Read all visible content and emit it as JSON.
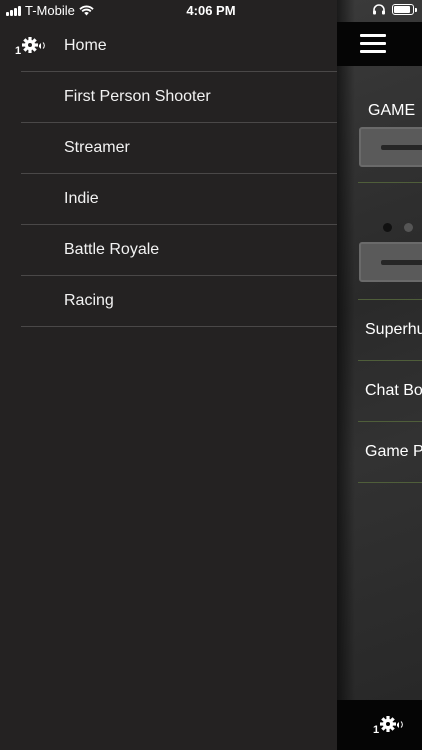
{
  "status_bar": {
    "carrier": "T-Mobile",
    "time": "4:06 PM",
    "battery_level": 0.8
  },
  "drawer": {
    "home_icon": "gear-volume-icon",
    "items": [
      {
        "label": "Home"
      },
      {
        "label": "First Person Shooter"
      },
      {
        "label": "Streamer"
      },
      {
        "label": "Indie"
      },
      {
        "label": "Battle Royale"
      },
      {
        "label": "Racing"
      }
    ]
  },
  "main": {
    "menu_icon": "hamburger-icon",
    "section_title": "GAME",
    "rows": [
      {
        "label": "Superhu"
      },
      {
        "label": "Chat Bo"
      },
      {
        "label": "Game P"
      }
    ],
    "bottom_icon": "gear-volume-icon"
  },
  "colors": {
    "drawer_bg": "#242222",
    "divider": "#4a4848",
    "accent_divider": "#4f5e3a",
    "bar_bg": "#050505"
  }
}
